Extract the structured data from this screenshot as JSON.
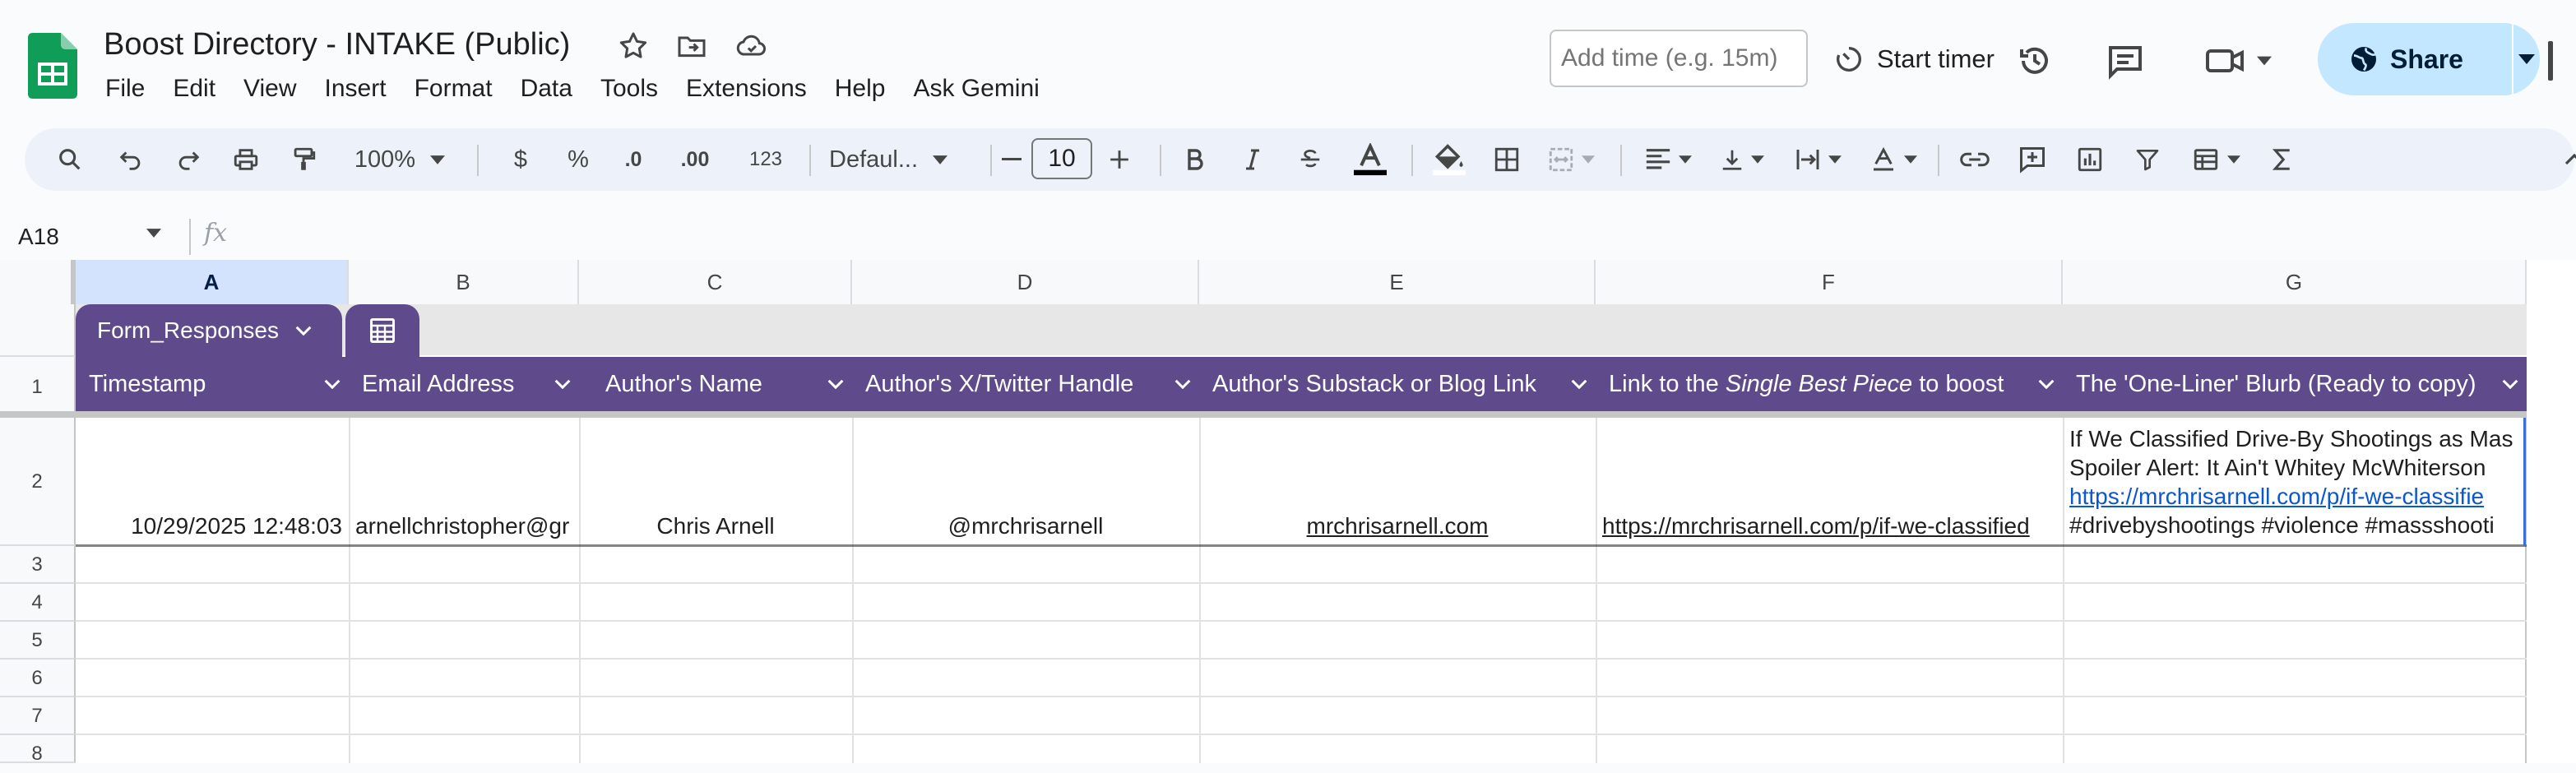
{
  "app": {
    "title": "Boost Directory - INTAKE (Public)",
    "accent": "#0f9d58",
    "menus": [
      "File",
      "Edit",
      "View",
      "Insert",
      "Format",
      "Data",
      "Tools",
      "Extensions",
      "Help",
      "Ask Gemini"
    ]
  },
  "header_right": {
    "time_placeholder": "Add time (e.g. 15m)",
    "start_timer": "Start timer",
    "share": "Share",
    "icons": [
      "history-icon",
      "comment-icon",
      "video-icon"
    ]
  },
  "toolbar": {
    "zoom": "100%",
    "currency": "$",
    "percent": "%",
    "decrease_decimal": ".0",
    "increase_decimal": ".00",
    "number_format": "123",
    "font": "Defaul...",
    "font_size": "10"
  },
  "formula_bar": {
    "cell_ref": "A18",
    "fx": "fx"
  },
  "sheet": {
    "columns": [
      "A",
      "B",
      "C",
      "D",
      "E",
      "F",
      "G"
    ],
    "selected_column": "A",
    "row_numbers": [
      "1",
      "2",
      "3",
      "4",
      "5",
      "6",
      "7",
      "8"
    ],
    "table_name": "Form_Responses",
    "table_color": "#5f4b8b",
    "headers": [
      "Timestamp",
      "Email Address",
      "Author's Name",
      "Author's X/Twitter Handle",
      "Author's Substack or Blog Link",
      {
        "pre": "Link to the ",
        "em": "Single Best Piece",
        "post": " to boost"
      },
      "The 'One-Liner' Blurb (Ready to copy)"
    ],
    "row2": {
      "timestamp": "10/29/2025 12:48:03",
      "email": "arnellchristopher@gr",
      "name": "Chris Arnell",
      "handle": "@mrchrisarnell",
      "blog": "mrchrisarnell.com",
      "piece": "https://mrchrisarnell.com/p/if-we-classified",
      "blurb": [
        "If We Classified Drive-By Shootings as Mas",
        "Spoiler Alert: It Ain't Whitey McWhiterson",
        "https://mrchrisarnell.com/p/if-we-classifie",
        "#drivebyshootings #violence #massshooti"
      ]
    }
  }
}
